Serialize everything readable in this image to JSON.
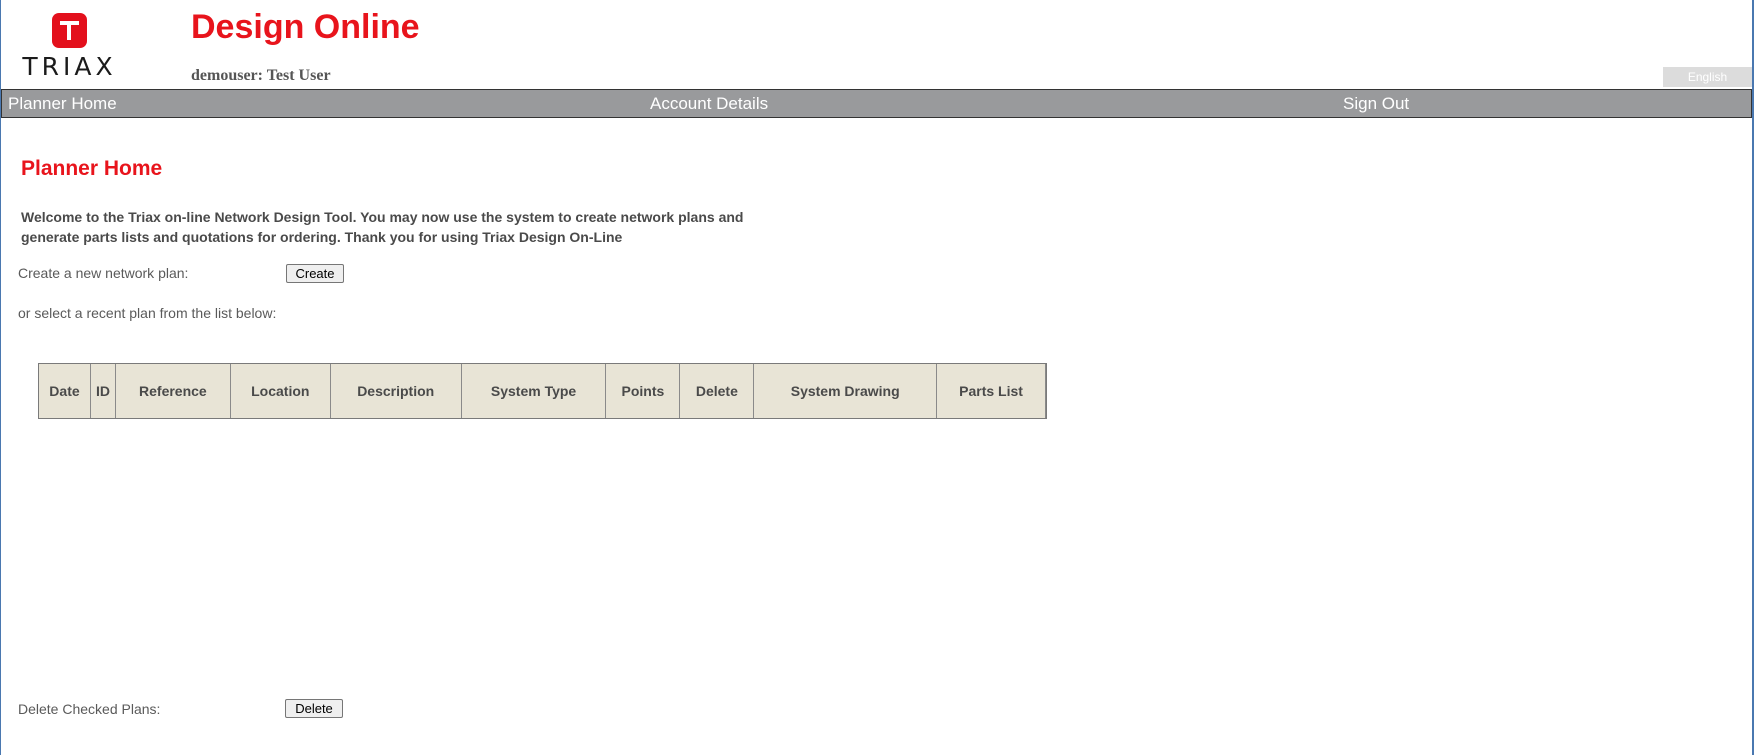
{
  "brand": {
    "logo_text": "TRIAX"
  },
  "header": {
    "title": "Design Online",
    "user": "demouser: Test User",
    "language": "English"
  },
  "nav": {
    "items": [
      {
        "label": "Planner Home"
      },
      {
        "label": "Account Details"
      },
      {
        "label": "Sign Out"
      }
    ]
  },
  "main": {
    "heading": "Planner Home",
    "welcome": "Welcome to the Triax on-line Network Design Tool. You may now use the system to create network plans and generate parts lists and quotations for ordering. Thank you for using Triax Design On-Line",
    "create_label": "Create a new network plan:",
    "create_button": "Create",
    "select_label": "or select a recent plan from the list below:",
    "table": {
      "columns": [
        "Date",
        "ID",
        "Reference",
        "Location",
        "Description",
        "System Type",
        "Points",
        "Delete",
        "System Drawing",
        "Parts List"
      ],
      "rows": []
    },
    "delete_label": "Delete Checked Plans:",
    "delete_button": "Delete"
  },
  "colors": {
    "brand_red": "#e8141c",
    "nav_bg": "#999a9c",
    "table_header_bg": "#e8e4d6"
  }
}
